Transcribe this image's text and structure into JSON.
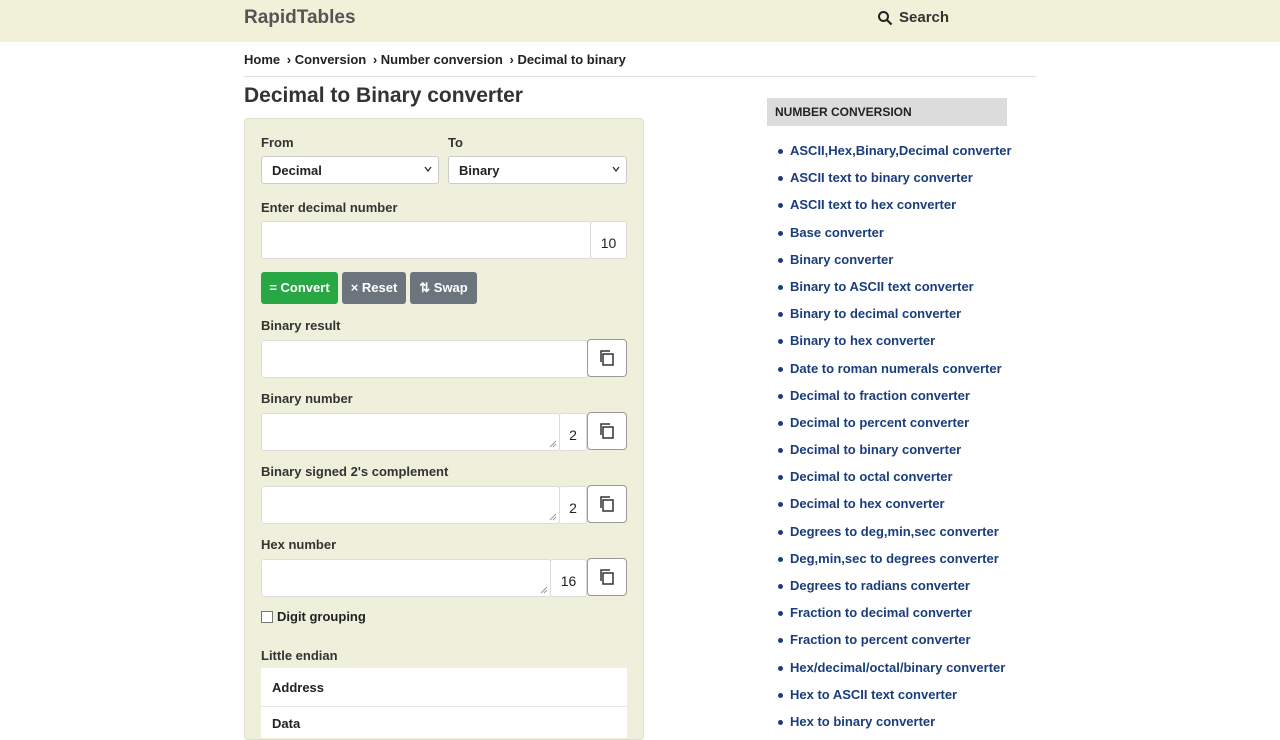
{
  "header": {
    "logo": "RapidTables",
    "search_label": "Search"
  },
  "breadcrumb": [
    "Home",
    "› Conversion",
    "› Number conversion",
    "› Decimal to binary"
  ],
  "page_title": "Decimal to Binary converter",
  "form": {
    "from_label": "From",
    "from_value": "Decimal",
    "to_label": "To",
    "to_value": "Binary",
    "input_label": "Enter decimal number",
    "input_radix": "10",
    "convert_label": "= Convert",
    "reset_label": "× Reset",
    "swap_label": "⇅ Swap",
    "binary_result_label": "Binary result",
    "binary_number_label": "Binary number",
    "binary_number_radix": "2",
    "signed_label": "Binary signed 2's complement",
    "signed_radix": "2",
    "hex_label": "Hex number",
    "hex_radix": "16",
    "digit_grouping_label": "Digit grouping",
    "little_endian_label": "Little endian",
    "table_address": "Address",
    "table_data": "Data"
  },
  "sidebar": {
    "heading": "NUMBER CONVERSION",
    "items": [
      "ASCII,Hex,Binary,Decimal converter",
      "ASCII text to binary converter",
      "ASCII text to hex converter",
      "Base converter",
      "Binary converter",
      "Binary to ASCII text converter",
      "Binary to decimal converter",
      "Binary to hex converter",
      "Date to roman numerals converter",
      "Decimal to fraction converter",
      "Decimal to percent converter",
      "Decimal to binary converter",
      "Decimal to octal converter",
      "Decimal to hex converter",
      "Degrees to deg,min,sec converter",
      "Deg,min,sec to degrees converter",
      "Degrees to radians converter",
      "Fraction to decimal converter",
      "Fraction to percent converter",
      "Hex/decimal/octal/binary converter",
      "Hex to ASCII text converter",
      "Hex to binary converter"
    ]
  },
  "colors": {
    "header_bg": "#f0f1d8",
    "panel_bg": "#eef0dc",
    "convert": "#28a745",
    "secondary": "#6c757d",
    "link": "#1a3d7c"
  }
}
